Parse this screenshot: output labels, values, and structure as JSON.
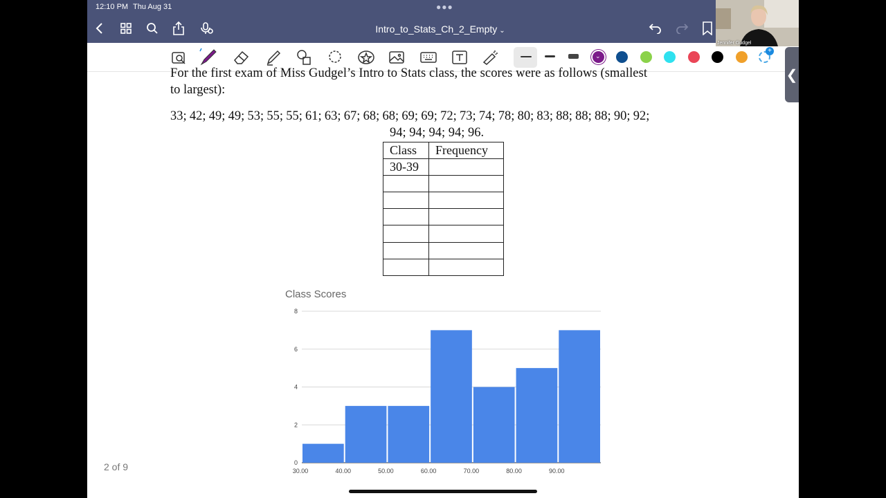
{
  "status": {
    "time": "12:10 PM",
    "date": "Thu Aug 31"
  },
  "app": {
    "title": "Intro_to_Stats_Ch_2_Empty"
  },
  "toolbar": {
    "colors": [
      "#7b1a8a",
      "#0f4f8f",
      "#8bd24a",
      "#2fe1ef",
      "#ea4557",
      "#000000",
      "#f0a02a"
    ]
  },
  "document": {
    "problem_line1": "For the first exam of Miss Gudgel’s Intro to Stats class, the scores were as follows (smallest",
    "problem_line2": "to largest):",
    "scores_line1": "33; 42; 49; 49; 53; 55; 55; 61; 63; 67; 68; 68; 69; 69; 72; 73; 74; 78; 80; 83; 88; 88; 88; 90; 92;",
    "scores_line2": "94; 94; 94; 94; 96.",
    "table": {
      "headers": [
        "Class",
        "Frequency"
      ],
      "rows": [
        [
          "30-39",
          ""
        ],
        [
          "",
          ""
        ],
        [
          "",
          ""
        ],
        [
          "",
          ""
        ],
        [
          "",
          ""
        ],
        [
          "",
          ""
        ],
        [
          "",
          ""
        ]
      ]
    }
  },
  "chart_data": {
    "type": "bar",
    "title": "Class Scores",
    "xlabel": "",
    "ylabel": "",
    "categories": [
      "30.00",
      "40.00",
      "50.00",
      "60.00",
      "70.00",
      "80.00",
      "90.00"
    ],
    "values": [
      1,
      3,
      3,
      7,
      4,
      5,
      7
    ],
    "ylim": [
      0,
      8
    ],
    "yticks": [
      0,
      2,
      4,
      6,
      8
    ],
    "color": "#4a86e8",
    "grid": true
  },
  "footer": {
    "page_indicator": "2 of 9"
  },
  "webcam": {
    "name": "Jennifer Gudgel"
  }
}
